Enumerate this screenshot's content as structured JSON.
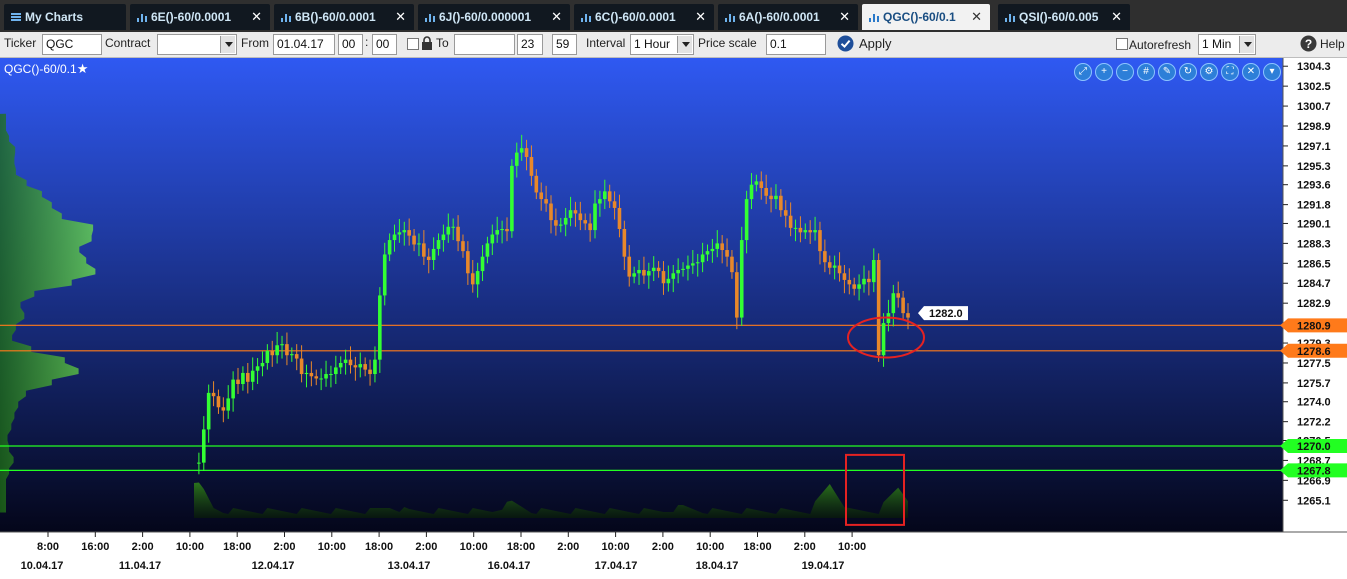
{
  "tabs": [
    {
      "label": "My Charts",
      "icon": "list-icon",
      "active": false
    },
    {
      "label": "6E()-60/0.0001",
      "icon": "chart-icon",
      "active": false
    },
    {
      "label": "6B()-60/0.0001",
      "icon": "chart-icon",
      "active": false
    },
    {
      "label": "6J()-60/0.000001",
      "icon": "chart-icon",
      "active": false
    },
    {
      "label": "6C()-60/0.0001",
      "icon": "chart-icon",
      "active": false
    },
    {
      "label": "6A()-60/0.0001",
      "icon": "chart-icon",
      "active": false
    },
    {
      "label": "QGC()-60/0.1",
      "icon": "chart-icon",
      "active": true
    },
    {
      "label": "QSI()-60/0.005",
      "icon": "chart-icon",
      "active": false
    }
  ],
  "toolbar": {
    "ticker_label": "Ticker",
    "ticker_value": "QGC",
    "contract_label": "Contract",
    "contract_value": "",
    "from_label": "From",
    "from_date": "01.04.17",
    "from_hour": "00",
    "from_min": "00",
    "to_label": "To",
    "to_date": "",
    "to_hour": "23",
    "to_min": "59",
    "interval_label": "Interval",
    "interval_value": "1 Hour",
    "price_scale_label": "Price scale",
    "price_scale_value": "0.1",
    "apply_label": "Apply",
    "autorefresh_label": "Autorefresh",
    "refresh_value": "1 Min",
    "help_label": "Help"
  },
  "chart": {
    "title": "QGC()-60/0.1",
    "toolbar_icons": [
      "zoom-fit-icon",
      "zoom-in-icon",
      "zoom-out-icon",
      "grid-icon",
      "draw-icon",
      "refresh-icon",
      "settings-icon",
      "fullscreen-icon",
      "close-icon",
      "menu-icon"
    ],
    "colors": {
      "bg_top": "#2f59f2",
      "bg_bottom": "#04061a",
      "candle_up": "#33ff33",
      "candle_down": "#e8882a",
      "level_orange": "#ff7a1a",
      "level_green": "#22ff22",
      "annotation_red": "#e52222"
    }
  },
  "chart_data": {
    "type": "candlestick",
    "y_axis": {
      "min": 1263.5,
      "max": 1304.5,
      "ticks": [
        "1304.3",
        "1302.5",
        "1300.7",
        "1298.9",
        "1297.1",
        "1295.3",
        "1293.6",
        "1291.8",
        "1290.1",
        "1288.3",
        "1286.5",
        "1284.7",
        "1282.9",
        "1281.1",
        "1279.3",
        "1277.5",
        "1275.7",
        "1274.0",
        "1272.2",
        "1270.5",
        "1268.7",
        "1266.9",
        "1265.1"
      ]
    },
    "x_axis": {
      "time_labels": [
        "8:00",
        "16:00",
        "2:00",
        "10:00",
        "18:00",
        "2:00",
        "10:00",
        "18:00",
        "2:00",
        "10:00",
        "18:00",
        "2:00",
        "10:00",
        "2:00",
        "10:00",
        "18:00",
        "2:00",
        "10:00"
      ],
      "date_labels": [
        "10.04.17",
        "11.04.17",
        "12.04.17",
        "13.04.17",
        "16.04.17",
        "17.04.17",
        "18.04.17",
        "19.04.17"
      ]
    },
    "price_levels": [
      {
        "value": 1280.9,
        "label": "1280.9",
        "color": "orange"
      },
      {
        "value": 1278.6,
        "label": "1278.6",
        "color": "orange"
      },
      {
        "value": 1270.0,
        "label": "1270.0",
        "color": "green"
      },
      {
        "value": 1267.8,
        "label": "1267.8",
        "color": "green"
      }
    ],
    "last_price": "1282.0",
    "price_path": [
      1268.5,
      1268.5,
      1271.5,
      1274.8,
      1274.5,
      1273.5,
      1273.2,
      1274.3,
      1276.0,
      1275.6,
      1276.6,
      1275.8,
      1276.8,
      1277.2,
      1277.5,
      1278.6,
      1278.2,
      1279.1,
      1279.2,
      1278.2,
      1278.3,
      1277.9,
      1276.5,
      1276.6,
      1276.3,
      1276.1,
      1276.1,
      1276.5,
      1276.5,
      1277.1,
      1277.5,
      1277.8,
      1277.3,
      1277.1,
      1277.4,
      1276.9,
      1276.5,
      1277.8,
      1283.6,
      1287.3,
      1288.6,
      1289.1,
      1289.3,
      1289.5,
      1289.0,
      1288.2,
      1288.3,
      1287.1,
      1286.8,
      1287.8,
      1288.6,
      1289.1,
      1289.8,
      1289.8,
      1288.5,
      1287.6,
      1285.6,
      1284.6,
      1285.8,
      1287.1,
      1288.3,
      1289.1,
      1289.5,
      1289.6,
      1289.4,
      1295.3,
      1296.5,
      1296.9,
      1296.1,
      1294.4,
      1292.9,
      1292.3,
      1291.9,
      1290.4,
      1289.9,
      1290.0,
      1290.6,
      1291.3,
      1291.0,
      1290.4,
      1290.1,
      1289.5,
      1291.9,
      1292.3,
      1293.0,
      1292.1,
      1291.5,
      1289.6,
      1287.1,
      1285.3,
      1285.6,
      1285.9,
      1285.4,
      1285.8,
      1286.1,
      1285.8,
      1284.7,
      1285.1,
      1285.6,
      1285.9,
      1286.0,
      1286.3,
      1286.5,
      1286.6,
      1287.3,
      1287.6,
      1287.8,
      1288.3,
      1287.7,
      1287.1,
      1285.7,
      1281.6,
      1288.6,
      1292.3,
      1293.6,
      1293.9,
      1293.3,
      1292.6,
      1292.3,
      1292.6,
      1291.3,
      1290.8,
      1289.7,
      1289.7,
      1289.3,
      1289.5,
      1289.3,
      1289.5,
      1287.6,
      1286.6,
      1286.1,
      1286.3,
      1285.6,
      1285.0,
      1284.6,
      1284.2,
      1284.6,
      1285.1,
      1284.8,
      1286.8,
      1278.2,
      1281.1,
      1282.0,
      1283.8,
      1283.4,
      1282.0,
      1281.6
    ]
  }
}
